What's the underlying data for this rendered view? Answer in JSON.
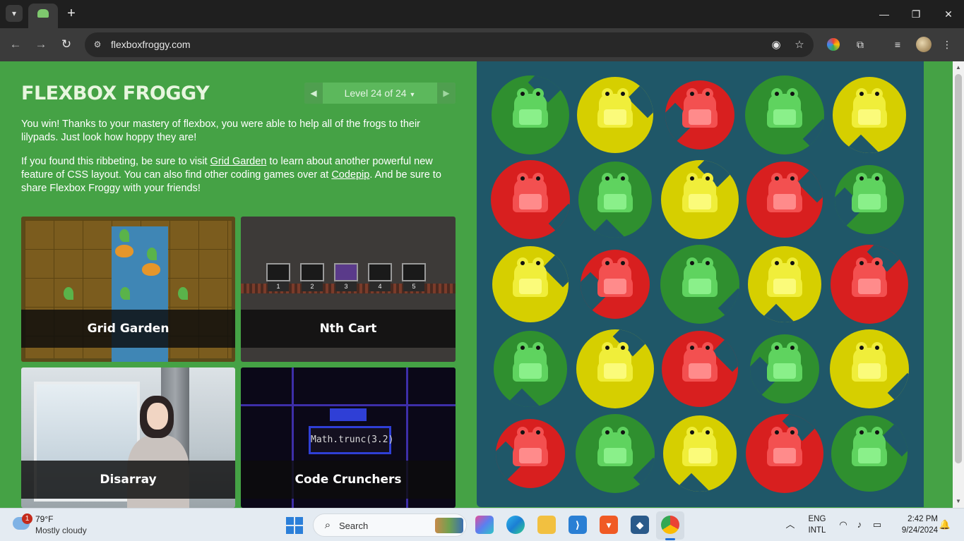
{
  "browser": {
    "url": "flexboxfroggy.com"
  },
  "game": {
    "title": "FLEXBOX FROGGY",
    "level_label": "Level 24 of 24",
    "win_p1": "You win! Thanks to your mastery of flexbox, you were able to help all of the frogs to their lilypads. Just look how hoppy they are!",
    "p2_a": "If you found this ribbeting, be sure to visit ",
    "p2_link1": "Grid Garden",
    "p2_b": " to learn about another powerful new feature of CSS layout. You can also find other coding games over at ",
    "p2_link2": "Codepip",
    "p2_c": ". And be sure to share Flexbox Froggy with your friends!",
    "games": [
      {
        "title": "Grid Garden"
      },
      {
        "title": "Nth Cart"
      },
      {
        "title": "Disarray"
      },
      {
        "title": "Code Crunchers"
      }
    ],
    "nth_cart_numbers": [
      "1",
      "2",
      "3",
      "4",
      "5"
    ],
    "code_snippet": "Math.trunc(3.2)",
    "pond": [
      [
        "green",
        "yellow",
        "red",
        "green",
        "yellow"
      ],
      [
        "red",
        "green",
        "yellow",
        "red",
        "green"
      ],
      [
        "yellow",
        "red",
        "green",
        "yellow",
        "red"
      ],
      [
        "green",
        "yellow",
        "red",
        "green",
        "yellow"
      ],
      [
        "red",
        "green",
        "yellow",
        "red",
        "green"
      ]
    ]
  },
  "colors": {
    "page_bg": "#45a245",
    "pond_bg": "#1f5768",
    "green": {
      "pad": "#2f8f2f",
      "light": "#5fd35f",
      "belly": "#8af08a"
    },
    "yellow": {
      "pad": "#d6cf00",
      "light": "#f0ee3a",
      "belly": "#fbfb7a"
    },
    "red": {
      "pad": "#d81f1f",
      "light": "#f35050",
      "belly": "#ff8b8b"
    }
  },
  "taskbar": {
    "weather_badge": "1",
    "weather_temp": "79°F",
    "weather_desc": "Mostly cloudy",
    "search_placeholder": "Search",
    "lang_top": "ENG",
    "lang_bottom": "INTL",
    "time": "2:42 PM",
    "date": "9/24/2024"
  }
}
